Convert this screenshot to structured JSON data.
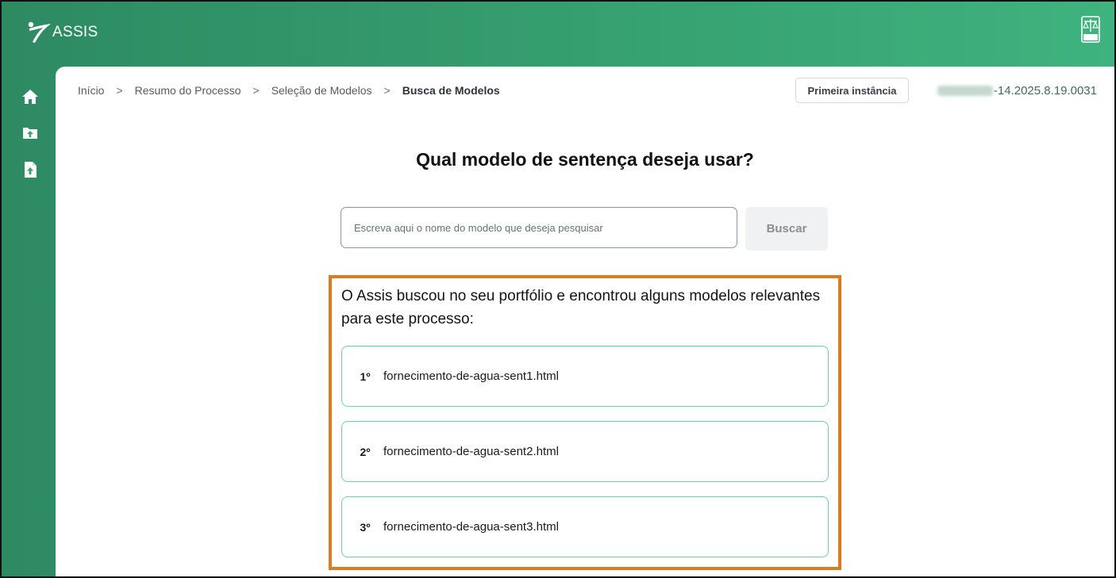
{
  "app": {
    "name": "ASSIS",
    "seal_text": "PJERJ"
  },
  "breadcrumb": [
    {
      "label": "Início"
    },
    {
      "label": "Resumo do Processo"
    },
    {
      "label": "Seleção de Modelos"
    },
    {
      "label": "Busca de Modelos"
    }
  ],
  "breadcrumb_separator": ">",
  "header": {
    "instance_button": "Primeira instância",
    "process_number_suffix": "-14.2025.8.19.0031"
  },
  "sidebar": {
    "items": [
      {
        "icon": "home-icon"
      },
      {
        "icon": "folder-upload-icon"
      },
      {
        "icon": "file-upload-icon"
      }
    ]
  },
  "main": {
    "question": "Qual modelo de sentença deseja usar?",
    "search": {
      "placeholder": "Escreva aqui o nome do modelo que deseja pesquisar",
      "value": "",
      "button_label": "Buscar"
    },
    "results": {
      "intro": "O Assis buscou no seu portfólio e encontrou alguns modelos relevantes para este processo:",
      "models": [
        {
          "rank": "1º",
          "name": "fornecimento-de-agua-sent1.html"
        },
        {
          "rank": "2º",
          "name": "fornecimento-de-agua-sent2.html"
        },
        {
          "rank": "3º",
          "name": "fornecimento-de-agua-sent3.html"
        }
      ]
    }
  },
  "colors": {
    "brand_green": "#36a070",
    "highlight_orange": "#e07a1f",
    "card_border": "#6fd1a8"
  }
}
